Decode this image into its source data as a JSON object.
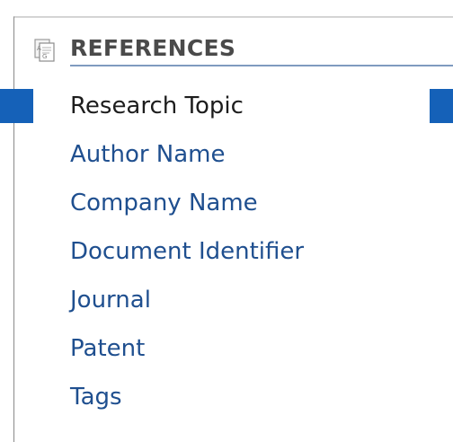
{
  "panel": {
    "title": "REFERENCES",
    "icon": "references-document-icon"
  },
  "menu": {
    "items": [
      {
        "label": "Research Topic",
        "active": true
      },
      {
        "label": "Author Name",
        "active": false
      },
      {
        "label": "Company Name",
        "active": false
      },
      {
        "label": "Document Identifier",
        "active": false
      },
      {
        "label": "Journal",
        "active": false
      },
      {
        "label": "Patent",
        "active": false
      },
      {
        "label": "Tags",
        "active": false
      }
    ]
  },
  "colors": {
    "link": "#1f4f8f",
    "active_text": "#1d1d1d",
    "active_marker": "#1561b8",
    "header_text": "#4a4a4a",
    "header_underline": "#7f9bbf"
  }
}
